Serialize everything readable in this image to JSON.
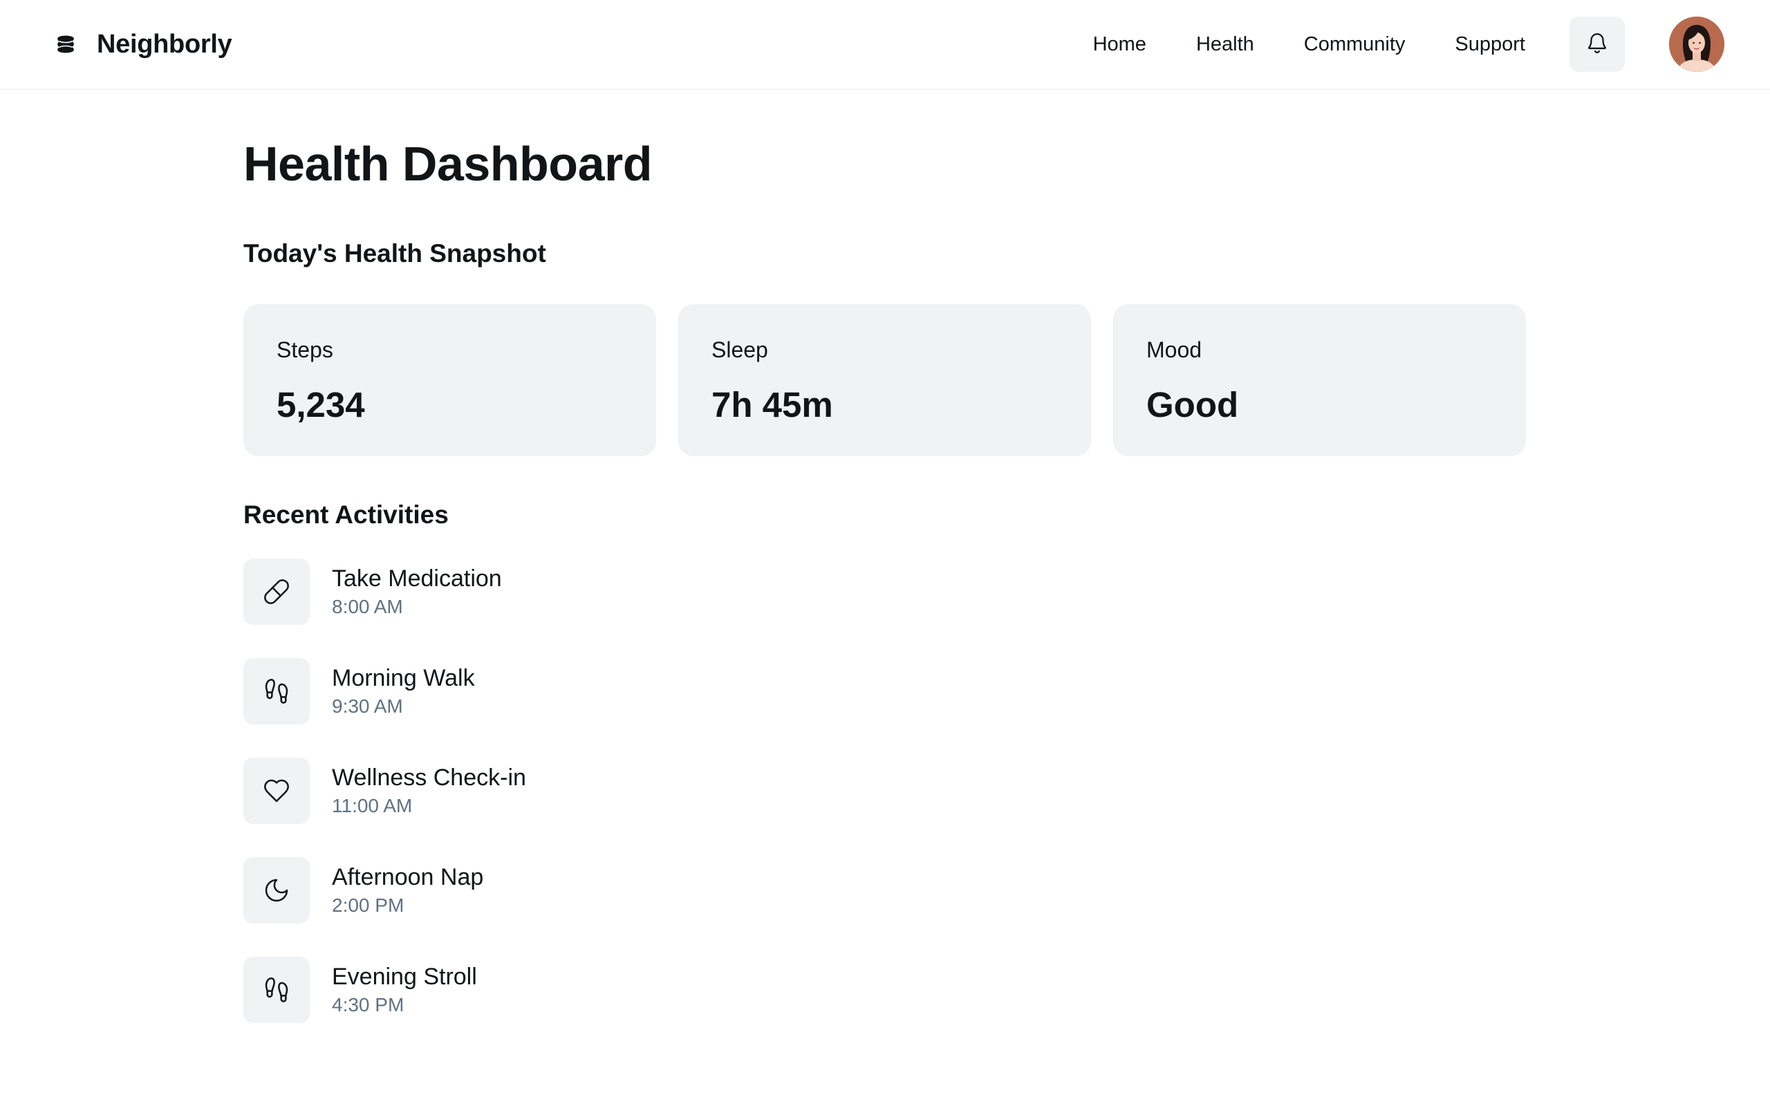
{
  "header": {
    "brand_name": "Neighborly",
    "logo_icon": "stack-logo-icon",
    "nav": [
      {
        "label": "Home"
      },
      {
        "label": "Health"
      },
      {
        "label": "Community"
      },
      {
        "label": "Support"
      }
    ],
    "notification_icon": "bell-icon",
    "avatar_icon": "user-avatar"
  },
  "main": {
    "title": "Health Dashboard",
    "snapshot_title": "Today's Health Snapshot",
    "stats": [
      {
        "label": "Steps",
        "value": "5,234"
      },
      {
        "label": "Sleep",
        "value": "7h 45m"
      },
      {
        "label": "Mood",
        "value": "Good"
      }
    ],
    "activities_title": "Recent Activities",
    "activities": [
      {
        "icon": "pill-icon",
        "name": "Take Medication",
        "time": "8:00 AM"
      },
      {
        "icon": "footprints-icon",
        "name": "Morning Walk",
        "time": "9:30 AM"
      },
      {
        "icon": "heart-icon",
        "name": "Wellness Check-in",
        "time": "11:00 AM"
      },
      {
        "icon": "moon-icon",
        "name": "Afternoon Nap",
        "time": "2:00 PM"
      },
      {
        "icon": "footprints-icon",
        "name": "Evening Stroll",
        "time": "4:30 PM"
      }
    ]
  },
  "colors": {
    "text": "#111518",
    "muted_text": "#5f7283",
    "card_background": "#f0f2f4",
    "divider": "#f0f2f4"
  }
}
